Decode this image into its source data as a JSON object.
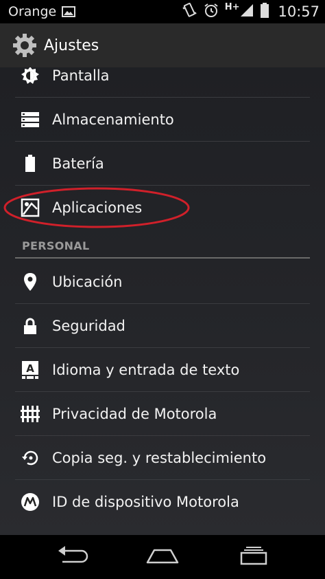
{
  "status_bar": {
    "carrier": "Orange",
    "network_type": "H+",
    "time": "10:57",
    "icons": [
      "image-notification-icon",
      "vibrate-icon",
      "alarm-icon",
      "signal-icon",
      "battery-icon"
    ]
  },
  "action_bar": {
    "title": "Ajustes",
    "icon": "settings-gear-icon"
  },
  "settings": {
    "device_items": [
      {
        "label": "Pantalla",
        "icon": "display-brightness-icon"
      },
      {
        "label": "Almacenamiento",
        "icon": "storage-icon"
      },
      {
        "label": "Batería",
        "icon": "battery-icon"
      },
      {
        "label": "Aplicaciones",
        "icon": "apps-icon",
        "highlighted": true
      }
    ],
    "personal_header": "PERSONAL",
    "personal_items": [
      {
        "label": "Ubicación",
        "icon": "location-pin-icon"
      },
      {
        "label": "Seguridad",
        "icon": "lock-icon"
      },
      {
        "label": "Idioma y entrada de texto",
        "icon": "keyboard-language-icon"
      },
      {
        "label": "Privacidad de Motorola",
        "icon": "fence-icon"
      },
      {
        "label": "Copia seg. y restablecimiento",
        "icon": "backup-restore-icon"
      },
      {
        "label": "ID de dispositivo Motorola",
        "icon": "motorola-logo-icon"
      }
    ]
  },
  "nav_bar": {
    "buttons": [
      "back-icon",
      "home-icon",
      "recents-icon"
    ]
  },
  "colors": {
    "annotation": "#d0202a",
    "action_bar": "#2a2a2a",
    "section_header": "#9a9a9a"
  }
}
